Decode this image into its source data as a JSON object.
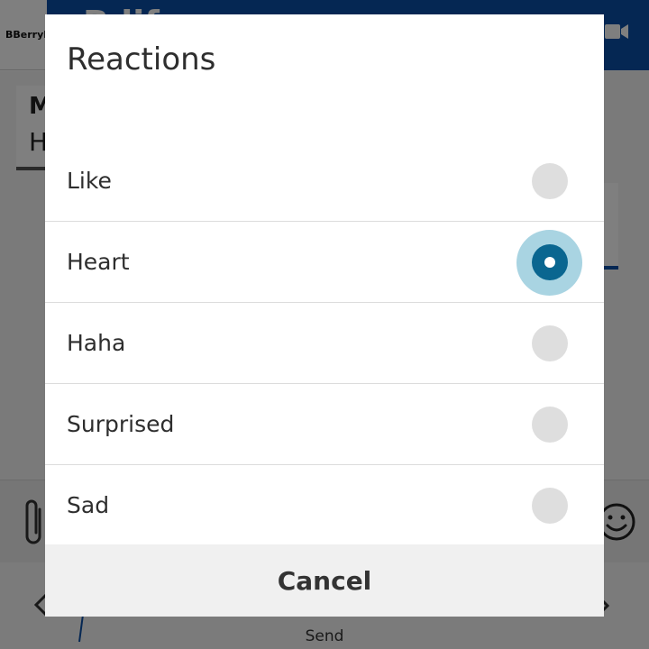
{
  "background_app": {
    "logo_text": "BBerryI",
    "title_partial": "B   lif",
    "message_sender_partial": "M",
    "message_preview_partial": "H",
    "send_label": "Send",
    "header_color": "#0b4fa6"
  },
  "dialog": {
    "title": "Reactions",
    "options": [
      {
        "label": "Like",
        "selected": false
      },
      {
        "label": "Heart",
        "selected": true
      },
      {
        "label": "Haha",
        "selected": false
      },
      {
        "label": "Surprised",
        "selected": false
      },
      {
        "label": "Sad",
        "selected": false
      }
    ],
    "cancel_label": "Cancel",
    "accent_color": "#0a6690"
  },
  "icons": {
    "video": "video-camera-icon",
    "attach": "paperclip-icon",
    "emoji": "smiley-icon",
    "back": "chevron-left-icon",
    "more": "more-icon"
  }
}
